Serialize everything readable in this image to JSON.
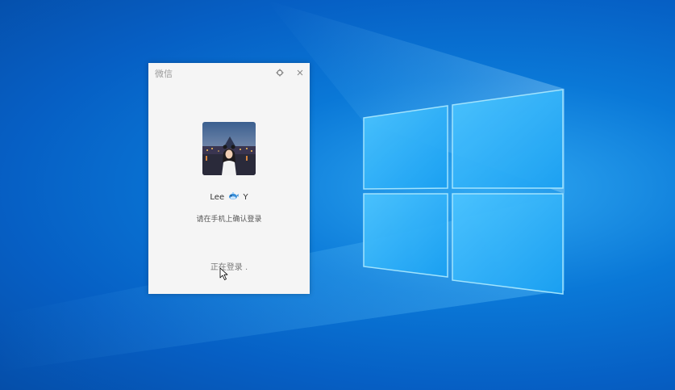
{
  "wechat_window": {
    "title": "微信",
    "user_name_part1": "Lee",
    "user_name_part2": "Y",
    "confirm_hint": "请在手机上确认登录",
    "status": "正在登录 ."
  },
  "icons": {
    "settings": "gear-icon",
    "close": "close-icon",
    "name_emoji": "whale-emoji-icon",
    "cursor": "mouse-pointer-icon",
    "wallpaper": "windows-logo"
  },
  "colors": {
    "desktop_blue": "#0a78d7",
    "window_bg": "#f5f5f5",
    "title_gray": "#9a9a9a"
  }
}
